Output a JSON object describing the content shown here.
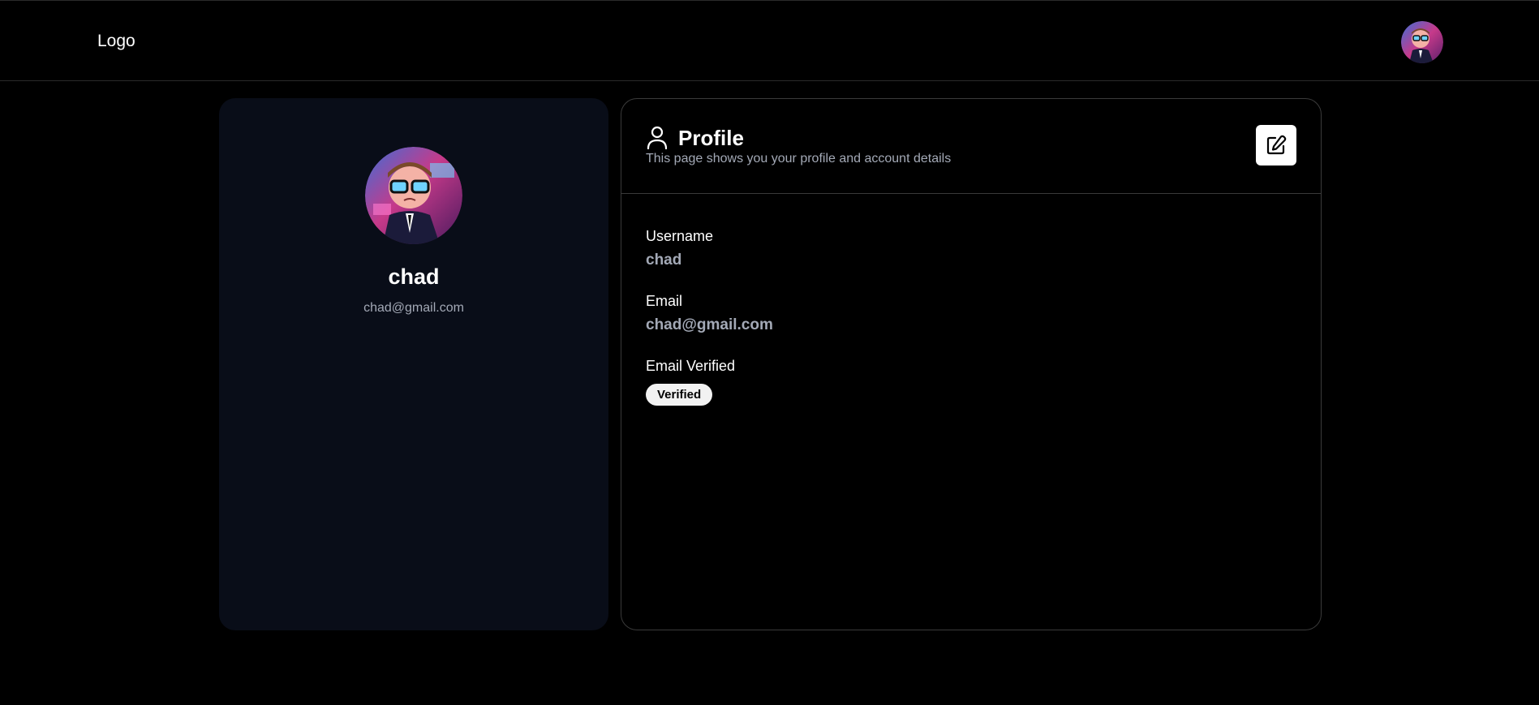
{
  "header": {
    "logo_text": "Logo",
    "avatar_icon": "user-avatar-image"
  },
  "sidebar_card": {
    "avatar_icon": "user-avatar-image",
    "name": "chad",
    "email": "chad@gmail.com",
    "background": "#090d18"
  },
  "profile": {
    "title_icon": "user-icon",
    "title": "Profile",
    "subtitle": "This page shows you your profile and account details",
    "edit_icon": "edit-icon",
    "fields": {
      "username": {
        "label": "Username",
        "value": "chad"
      },
      "email": {
        "label": "Email",
        "value": "chad@gmail.com"
      },
      "email_verified": {
        "label": "Email Verified",
        "value": "Verified"
      }
    }
  },
  "colors": {
    "background": "#000000",
    "muted_text": "#a3a9b6",
    "border": "#3a3a3a",
    "badge_bg": "#f2f2f2"
  }
}
